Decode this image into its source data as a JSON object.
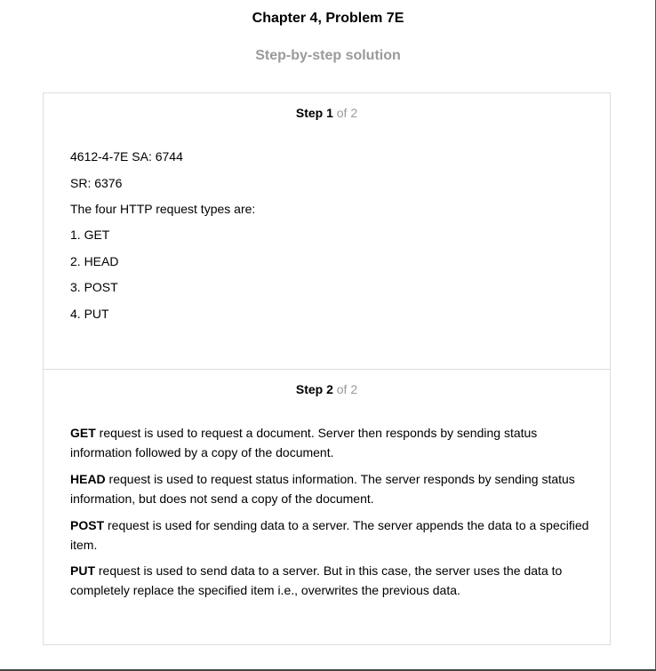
{
  "header": {
    "title": "Chapter 4, Problem 7E",
    "subtitle": "Step-by-step solution"
  },
  "step1": {
    "label": "Step 1",
    "of": "of 2",
    "lines": [
      "4612-4-7E SA: 6744",
      "SR: 6376",
      "The four HTTP request types are:",
      "1. GET",
      "2. HEAD",
      "3. POST",
      "4. PUT"
    ]
  },
  "step2": {
    "label": "Step 2",
    "of": "of 2",
    "paragraphs": [
      {
        "term": "GET",
        "text": " request is used to request a document. Server then responds by sending status information followed by a copy of the document."
      },
      {
        "term": "HEAD",
        "text": " request is used to request status information. The server responds by sending status information, but does not send a copy of the document."
      },
      {
        "term": "POST",
        "text": " request is used for sending data to a server. The server appends the data to a specified item."
      },
      {
        "term": "PUT",
        "text": " request is used to send data to a server. But in this case, the server uses the data to completely replace the specified item i.e., overwrites the previous data."
      }
    ]
  }
}
